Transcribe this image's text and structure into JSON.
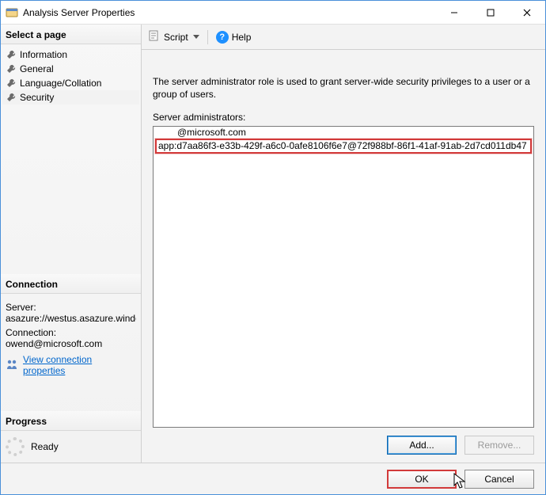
{
  "window": {
    "title": "Analysis Server Properties"
  },
  "left": {
    "select_page_header": "Select a page",
    "pages": {
      "information": "Information",
      "general": "General",
      "language": "Language/Collation",
      "security": "Security"
    },
    "connection_header": "Connection",
    "server_label": "Server:",
    "server_value": "asazure://westus.asazure.windows",
    "connection_label": "Connection:",
    "connection_value": "owend@microsoft.com",
    "view_conn_props": "View connection properties",
    "progress_header": "Progress",
    "progress_status": "Ready"
  },
  "right": {
    "script_label": "Script",
    "help_label": "Help",
    "description": "The server administrator role is used to grant server-wide security privileges to a user or a group of users.",
    "admins_label": "Server administrators:",
    "admins": {
      "row1": "@microsoft.com",
      "row2": "app:d7aa86f3-e33b-429f-a6c0-0afe8106f6e7@72f988bf-86f1-41af-91ab-2d7cd011db47"
    },
    "add_btn": "Add...",
    "remove_btn": "Remove..."
  },
  "footer": {
    "ok": "OK",
    "cancel": "Cancel"
  }
}
